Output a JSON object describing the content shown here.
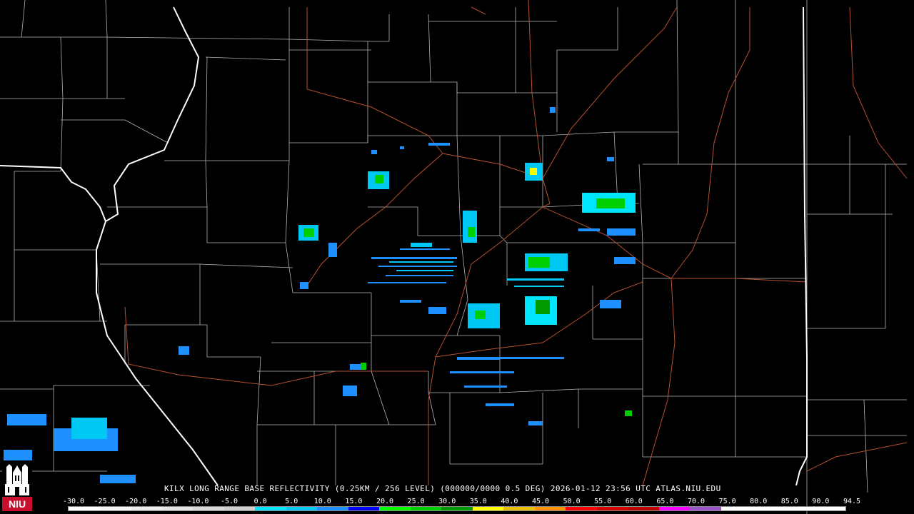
{
  "caption": {
    "station": "KILX",
    "product": "LONG RANGE BASE REFLECTIVITY",
    "resolution": "(0.25KM / 256 LEVEL)",
    "code": "(000000/0000",
    "elevation": "0.5 DEG)",
    "datetime": "2026-01-12 23:56 UTC",
    "site": "ATLAS.NIU.EDU"
  },
  "scale": {
    "labels": [
      "-30.0",
      "-25.0",
      "-20.0",
      "-15.0",
      "-10.0",
      "-5.0",
      "0.0",
      "5.0",
      "10.0",
      "15.0",
      "20.0",
      "25.0",
      "30.0",
      "35.0",
      "40.0",
      "45.0",
      "50.0",
      "55.0",
      "60.0",
      "65.0",
      "70.0",
      "75.0",
      "80.0",
      "85.0",
      "90.0",
      "94.5"
    ],
    "colors": [
      "#ffffff",
      "#f8f8f8",
      "#eeeeee",
      "#e4e4e4",
      "#dadada",
      "#d0d0d0",
      "#00e5ff",
      "#00c8f5",
      "#1e90ff",
      "#0000ff",
      "#00ff00",
      "#00d000",
      "#009a00",
      "#ffff00",
      "#e8c000",
      "#ff9000",
      "#ff0000",
      "#d40000",
      "#c00000",
      "#ff00ff",
      "#9955c9",
      "#ffffff",
      "#ffffff",
      "#ffffff",
      "#ffffff"
    ]
  },
  "logo": {
    "text": "NIU",
    "colors": {
      "red": "#c8102e",
      "white": "#ffffff"
    }
  },
  "map_colors": {
    "county": "#b4b4b4",
    "state": "#ffffff",
    "highway": "#b5512f",
    "background": "#000000"
  }
}
